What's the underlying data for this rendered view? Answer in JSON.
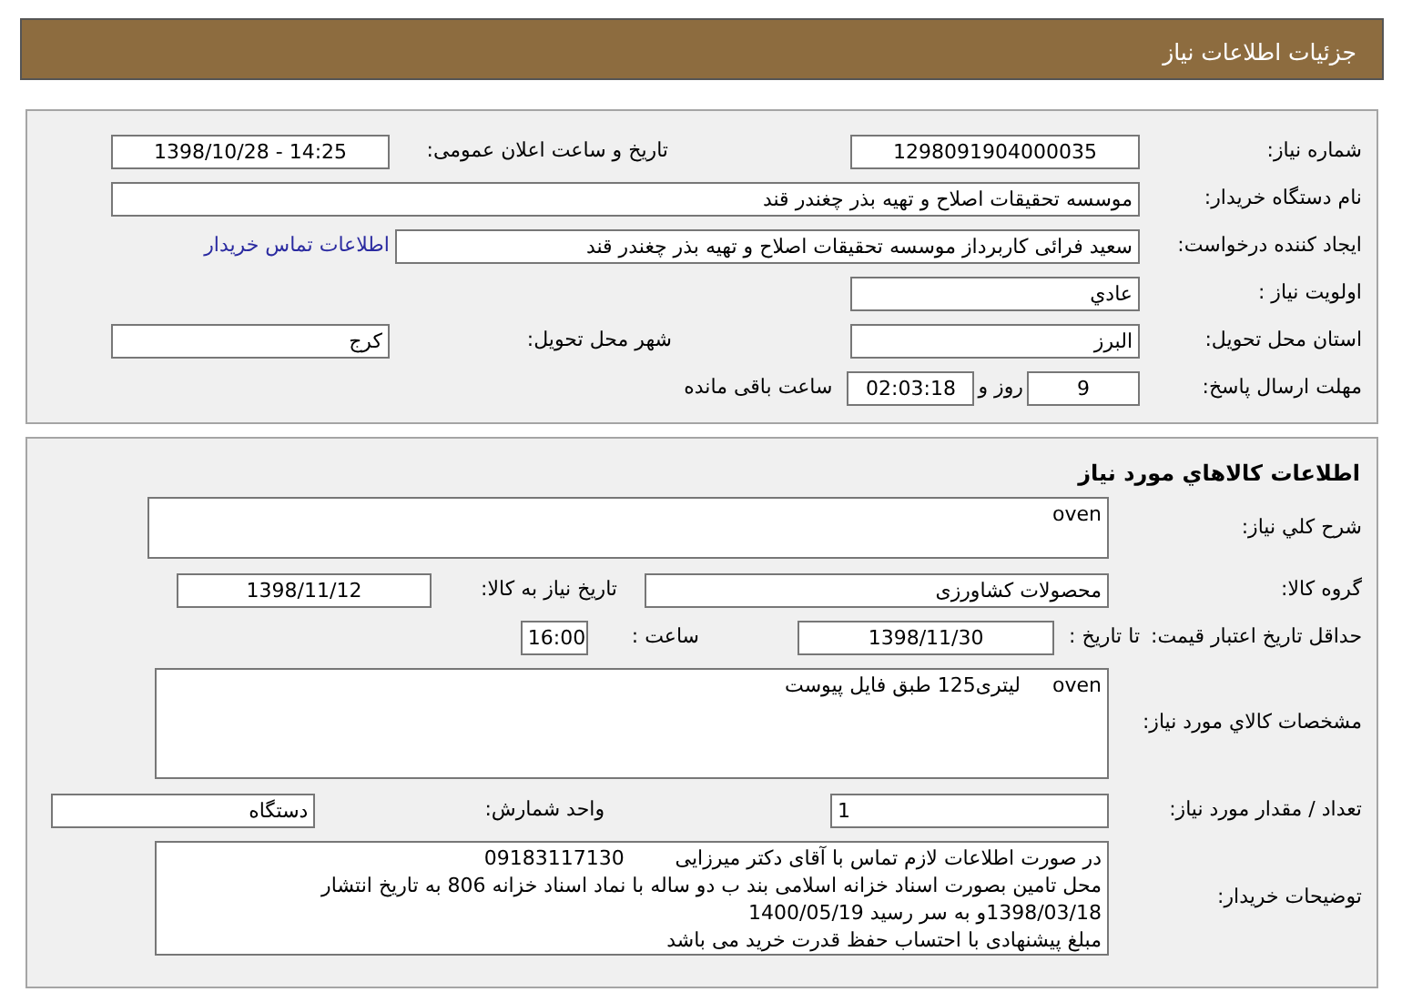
{
  "header": {
    "title": "جزئیات اطلاعات نیاز"
  },
  "sections": [
    {
      "rows": [
        [
          {
            "kind": "label",
            "text": "شماره نیاز:"
          },
          {
            "kind": "field",
            "value": "1298091904000035"
          },
          {
            "kind": "label",
            "text": "تاریخ و ساعت اعلان عمومی:"
          },
          {
            "kind": "field",
            "value": "1398/10/28 - 14:25"
          }
        ],
        [
          {
            "kind": "label",
            "text": "نام دستگاه خریدار:"
          },
          {
            "kind": "field",
            "value": "موسسه تحقیقات اصلاح و تهیه بذر چغندر قند"
          }
        ],
        [
          {
            "kind": "label",
            "text": "ایجاد کننده درخواست:"
          },
          {
            "kind": "field",
            "value": "سعید فرائی کاربرداز موسسه تحقیقات اصلاح و تهیه بذر چغندر قند"
          },
          {
            "kind": "gap"
          },
          {
            "kind": "link",
            "text": "اطلاعات تماس خریدار"
          }
        ],
        [
          {
            "kind": "label",
            "text": "اولویت نیاز :"
          },
          {
            "kind": "field",
            "value": "عادي"
          }
        ],
        [
          {
            "kind": "label",
            "text": "استان محل تحویل:"
          },
          {
            "kind": "field",
            "value": "البرز"
          },
          {
            "kind": "label",
            "text": "شهر محل تحویل:"
          },
          {
            "kind": "field",
            "value": "کرج"
          }
        ],
        [
          {
            "kind": "label",
            "text": "مهلت ارسال پاسخ:"
          },
          {
            "kind": "deadline",
            "days": "9",
            "days_unit": "روز و",
            "time": "02:03:18",
            "suffix": "ساعت باقی مانده"
          }
        ]
      ]
    },
    {
      "title": "اطلاعات کالاهاي مورد نياز",
      "rows": [
        [
          {
            "kind": "label",
            "text": "شرح کلي نياز:"
          },
          {
            "kind": "area",
            "value": "oven"
          }
        ],
        [
          {
            "kind": "label",
            "text": "گروه کالا:"
          },
          {
            "kind": "field",
            "value": "محصولات کشاورزی"
          },
          {
            "kind": "label",
            "text": "تاریخ نیاز به کالا:"
          },
          {
            "kind": "field",
            "value": "1398/11/12"
          }
        ],
        [
          {
            "kind": "label",
            "text": "حداقل تاریخ اعتبار قیمت:"
          },
          {
            "kind": "text",
            "text": "تا تاریخ :"
          },
          {
            "kind": "field",
            "value": "1398/11/30"
          },
          {
            "kind": "text",
            "text": "ساعت :"
          },
          {
            "kind": "field",
            "value": "16:00"
          }
        ],
        [
          {
            "kind": "label",
            "text": "مشخصات کالاي مورد نياز:"
          },
          {
            "kind": "area",
            "value": "oven     لیتری125 طبق فایل پیوست"
          }
        ],
        [
          {
            "kind": "label",
            "text": "تعداد / مقدار مورد نیاز:"
          },
          {
            "kind": "field",
            "value": "1"
          },
          {
            "kind": "label",
            "text": "واحد شمارش:"
          },
          {
            "kind": "field",
            "value": "دستگاه"
          }
        ],
        [
          {
            "kind": "label",
            "text": "توضیحات خریدار:"
          },
          {
            "kind": "notes",
            "lines": [
              "در صورت اطلاعات لازم تماس با آقای دکتر میرزایی        09183117130",
              "محل تامین بصورت اسناد خزانه اسلامی بند ب دو ساله با نماد اسناد خزانه 806 به تاریخ انتشار",
              "1398/03/18و به سر رسید 1400/05/19",
              "مبلغ پیشنهادی با احتساب حفظ قدرت خرید می باشد"
            ]
          }
        ]
      ]
    }
  ]
}
